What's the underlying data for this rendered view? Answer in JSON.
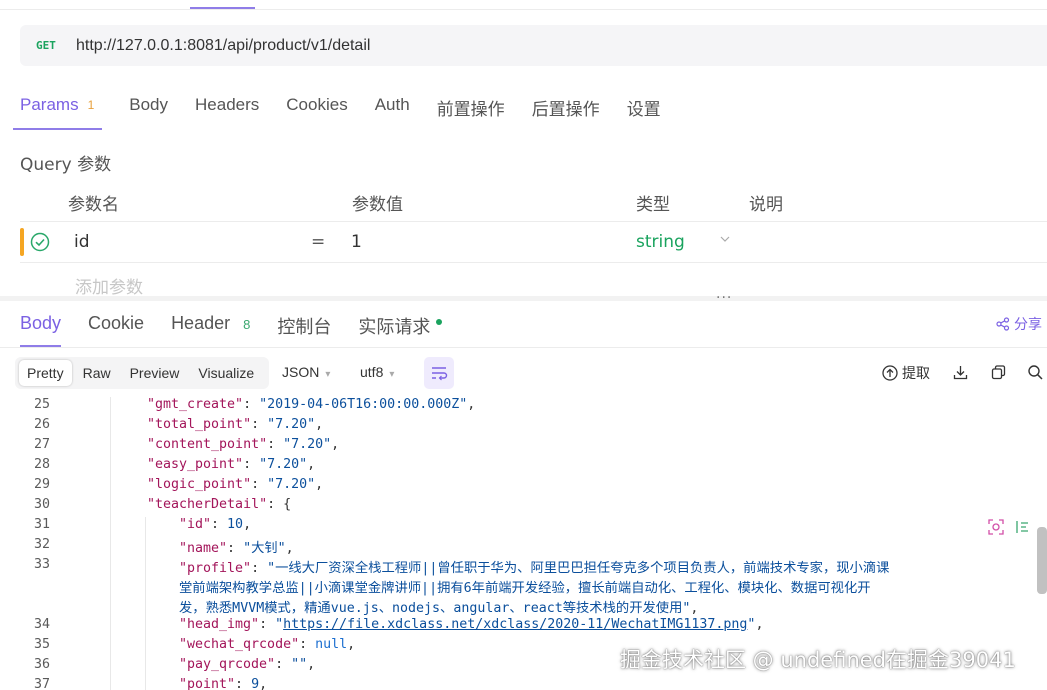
{
  "request": {
    "method": "GET",
    "url": "http://127.0.0.1:8081/api/product/v1/detail",
    "tabs": [
      {
        "label": "Params",
        "badge": "1"
      },
      {
        "label": "Body"
      },
      {
        "label": "Headers"
      },
      {
        "label": "Cookies"
      },
      {
        "label": "Auth"
      },
      {
        "label": "前置操作"
      },
      {
        "label": "后置操作"
      },
      {
        "label": "设置"
      }
    ],
    "active_tab": "Params"
  },
  "query": {
    "title": "Query 参数",
    "columns": [
      "参数名",
      "参数值",
      "类型",
      "说明"
    ],
    "rows": [
      {
        "name": "id",
        "eq": "=",
        "value": "1",
        "type": "string",
        "desc": "",
        "enabled": true
      }
    ],
    "add_placeholder": "添加参数"
  },
  "splitter_handle": "···",
  "response": {
    "tabs": [
      {
        "label": "Body"
      },
      {
        "label": "Cookie"
      },
      {
        "label": "Header",
        "badge": "8"
      },
      {
        "label": "控制台"
      },
      {
        "label": "实际请求"
      }
    ],
    "active_tab": "Body",
    "share_label": "分享",
    "view_modes": [
      "Pretty",
      "Raw",
      "Preview",
      "Visualize"
    ],
    "active_view": "Pretty",
    "format": "JSON",
    "encoding": "utf8",
    "extract_label": "提取",
    "status_dot_color": "#1aa35e"
  },
  "code": {
    "lines": [
      {
        "n": "25",
        "indent": 0,
        "k": "gmt_create",
        "v": "2019-04-06T16:00:00.000Z",
        "t": "str",
        "end": ","
      },
      {
        "n": "26",
        "indent": 0,
        "k": "total_point",
        "v": "7.20",
        "t": "str",
        "end": ","
      },
      {
        "n": "27",
        "indent": 0,
        "k": "content_point",
        "v": "7.20",
        "t": "str",
        "end": ","
      },
      {
        "n": "28",
        "indent": 0,
        "k": "easy_point",
        "v": "7.20",
        "t": "str",
        "end": ","
      },
      {
        "n": "29",
        "indent": 0,
        "k": "logic_point",
        "v": "7.20",
        "t": "str",
        "end": ","
      },
      {
        "n": "30",
        "indent": 0,
        "k": "teacherDetail",
        "v": "{",
        "t": "pun",
        "end": ""
      },
      {
        "n": "31",
        "indent": 1,
        "k": "id",
        "v": "10",
        "t": "num",
        "end": ","
      },
      {
        "n": "32",
        "indent": 1,
        "k": "name",
        "v": "大钊",
        "t": "str",
        "end": ","
      },
      {
        "n": "33",
        "indent": 1,
        "k": "profile",
        "v": "一线大厂资深全栈工程师||曾任职于华为、阿里巴巴担任夸克多个项目负责人，前端技术专家，现小滴课",
        "t": "str",
        "end": ""
      },
      {
        "n": "",
        "indent": 1,
        "k": "",
        "v": "堂前端架构教学总监||小滴课堂金牌讲师||拥有6年前端开发经验，擅长前端自动化、工程化、模块化、数据可视化开",
        "t": "cont",
        "end": ""
      },
      {
        "n": "",
        "indent": 1,
        "k": "",
        "v": "发，熟悉MVVM模式，精通vue.js、nodejs、angular、react等技术栈的开发使用",
        "t": "contend",
        "end": ","
      },
      {
        "n": "34",
        "indent": 1,
        "k": "head_img",
        "v": "https://file.xdclass.net/xdclass/2020-11/WechatIMG1137.png",
        "t": "link",
        "end": ","
      },
      {
        "n": "35",
        "indent": 1,
        "k": "wechat_qrcode",
        "v": "null",
        "t": "kw",
        "end": ","
      },
      {
        "n": "36",
        "indent": 1,
        "k": "pay_qrcode",
        "v": "",
        "t": "str",
        "end": ","
      },
      {
        "n": "37",
        "indent": 1,
        "k": "point",
        "v": "9",
        "t": "num",
        "end": ","
      }
    ]
  },
  "watermark": "掘金技术社区 @ undefined在掘金39041"
}
